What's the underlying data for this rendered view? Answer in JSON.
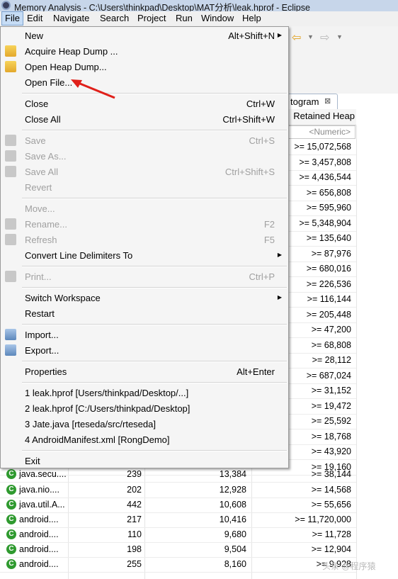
{
  "window": {
    "title": "Memory Analysis - C:\\Users\\thinkpad\\Desktop\\MAT分析\\leak.hprof - Eclipse"
  },
  "menubar": [
    {
      "label": "File"
    },
    {
      "label": "Edit"
    },
    {
      "label": "Navigate"
    },
    {
      "label": "Search"
    },
    {
      "label": "Project"
    },
    {
      "label": "Run"
    },
    {
      "label": "Window"
    },
    {
      "label": "Help"
    }
  ],
  "editor": {
    "tab_label": "togram",
    "close_glyph": "⊠",
    "retained_header": "Retained Heap",
    "filter_placeholder": "<Numeric>"
  },
  "file_menu": {
    "new": {
      "label": "New",
      "shortcut": "Alt+Shift+N"
    },
    "acquire": {
      "label": "Acquire Heap Dump ..."
    },
    "open_heap": {
      "label": "Open Heap Dump..."
    },
    "open_file": {
      "label": "Open File..."
    },
    "close": {
      "label": "Close",
      "shortcut": "Ctrl+W"
    },
    "close_all": {
      "label": "Close All",
      "shortcut": "Ctrl+Shift+W"
    },
    "save": {
      "label": "Save",
      "shortcut": "Ctrl+S"
    },
    "save_as": {
      "label": "Save As..."
    },
    "save_all": {
      "label": "Save All",
      "shortcut": "Ctrl+Shift+S"
    },
    "revert": {
      "label": "Revert"
    },
    "move": {
      "label": "Move..."
    },
    "rename": {
      "label": "Rename...",
      "shortcut": "F2"
    },
    "refresh": {
      "label": "Refresh",
      "shortcut": "F5"
    },
    "convert": {
      "label": "Convert Line Delimiters To"
    },
    "print": {
      "label": "Print...",
      "shortcut": "Ctrl+P"
    },
    "switch_ws": {
      "label": "Switch Workspace"
    },
    "restart": {
      "label": "Restart"
    },
    "import": {
      "label": "Import..."
    },
    "export": {
      "label": "Export..."
    },
    "properties": {
      "label": "Properties",
      "shortcut": "Alt+Enter"
    },
    "recent1": {
      "label": "1 leak.hprof  [Users/thinkpad/Desktop/...]"
    },
    "recent2": {
      "label": "2 leak.hprof  [C:/Users/thinkpad/Desktop]"
    },
    "recent3": {
      "label": "3 Jate.java  [rteseda/src/rteseda]"
    },
    "recent4": {
      "label": "4 AndroidManifest.xml  [RongDemo]"
    },
    "exit": {
      "label": "Exit"
    }
  },
  "retained_values": [
    ">= 15,072,568",
    ">= 3,457,808",
    ">= 4,436,544",
    ">= 656,808",
    ">= 595,960",
    ">= 5,348,904",
    ">= 135,640",
    ">= 87,976",
    ">= 680,016",
    ">= 226,536",
    ">= 116,144",
    ">= 205,448",
    ">= 47,200",
    ">= 68,808",
    ">= 28,112",
    ">= 687,024",
    ">= 31,152",
    ">= 19,472",
    ">= 25,592",
    ">= 18,768",
    ">= 43,920",
    ">= 19,160"
  ],
  "visible_rows": [
    {
      "name": "java.secu....",
      "objects": "239",
      "shallow": "13,384",
      "retained": ">= 38,144"
    },
    {
      "name": "java.nio....",
      "objects": "202",
      "shallow": "12,928",
      "retained": ">= 14,568"
    },
    {
      "name": "java.util.A...",
      "objects": "442",
      "shallow": "10,608",
      "retained": ">= 55,656"
    },
    {
      "name": "android....",
      "objects": "217",
      "shallow": "10,416",
      "retained": ">= 11,720,000"
    },
    {
      "name": "android....",
      "objects": "110",
      "shallow": "9,680",
      "retained": ">= 11,728"
    },
    {
      "name": "android....",
      "objects": "198",
      "shallow": "9,504",
      "retained": ">= 12,904"
    },
    {
      "name": "android....",
      "objects": "255",
      "shallow": "8,160",
      "retained": ">= 9,928"
    }
  ],
  "watermark": "头条 @程序猿"
}
